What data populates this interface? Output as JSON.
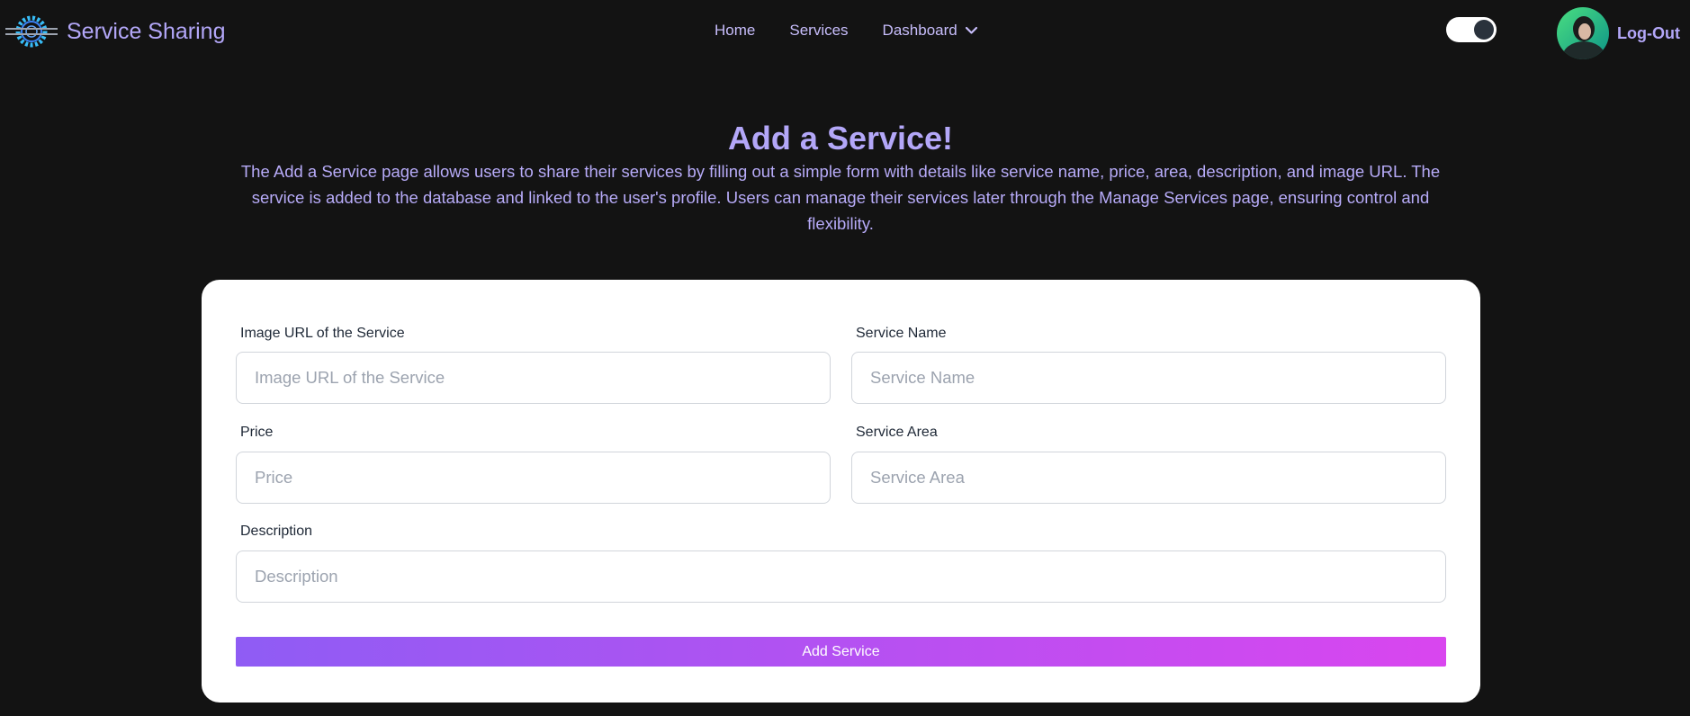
{
  "nav": {
    "brand": "Service Sharing",
    "links": {
      "home": "Home",
      "services": "Services",
      "dashboard": "Dashboard"
    },
    "logout": "Log-Out",
    "theme_toggle_on": true
  },
  "header": {
    "title": "Add a Service!",
    "description": "The Add a Service page allows users to share their services by filling out a simple form with details like service name, price, area, description, and image URL. The service is added to the database and linked to the user's profile. Users can manage their services later through the Manage Services page, ensuring control and flexibility."
  },
  "form": {
    "image_url": {
      "label": "Image URL of the Service",
      "placeholder": "Image URL of the Service",
      "value": ""
    },
    "service_name": {
      "label": "Service Name",
      "placeholder": "Service Name",
      "value": ""
    },
    "price": {
      "label": "Price",
      "placeholder": "Price",
      "value": ""
    },
    "service_area": {
      "label": "Service Area",
      "placeholder": "Service Area",
      "value": ""
    },
    "description": {
      "label": "Description",
      "placeholder": "Description",
      "value": ""
    },
    "submit_label": "Add Service"
  },
  "colors": {
    "background": "#131313",
    "accent": "#b3a7f8",
    "card": "#ffffff",
    "button_gradient_start": "#8f5cf4",
    "button_gradient_end": "#d946ef"
  },
  "icons": {
    "logo": "gear-logo-icon",
    "dropdown": "chevron-down-icon",
    "avatar": "user-avatar"
  }
}
